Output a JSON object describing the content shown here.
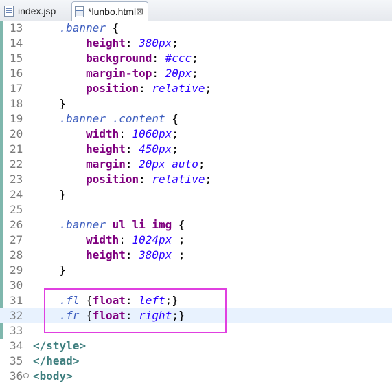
{
  "tabs": [
    {
      "label": "index.jsp",
      "icon": "jsp-file-icon"
    },
    {
      "label": "*lunbo.html",
      "icon": "html-file-icon",
      "close": "⊠",
      "active": true
    }
  ],
  "highlight_color": "#e040e0",
  "lines": [
    {
      "n": "13",
      "tokens": [
        [
          "    ",
          "pun"
        ],
        [
          ".banner",
          "sel"
        ],
        [
          " {",
          "pun"
        ]
      ]
    },
    {
      "n": "14",
      "tokens": [
        [
          "        ",
          "pun"
        ],
        [
          "height",
          "prop"
        ],
        [
          ": ",
          "pun"
        ],
        [
          "380px",
          "val"
        ],
        [
          ";",
          "pun"
        ]
      ]
    },
    {
      "n": "15",
      "tokens": [
        [
          "        ",
          "pun"
        ],
        [
          "background",
          "prop"
        ],
        [
          ": ",
          "pun"
        ],
        [
          "#ccc",
          "val"
        ],
        [
          ";",
          "pun"
        ]
      ]
    },
    {
      "n": "16",
      "tokens": [
        [
          "        ",
          "pun"
        ],
        [
          "margin-top",
          "prop"
        ],
        [
          ": ",
          "pun"
        ],
        [
          "20px",
          "val"
        ],
        [
          ";",
          "pun"
        ]
      ]
    },
    {
      "n": "17",
      "tokens": [
        [
          "        ",
          "pun"
        ],
        [
          "position",
          "prop"
        ],
        [
          ": ",
          "pun"
        ],
        [
          "relative",
          "val"
        ],
        [
          ";",
          "pun"
        ]
      ]
    },
    {
      "n": "18",
      "tokens": [
        [
          "    ",
          "pun"
        ],
        [
          "}",
          "pun"
        ]
      ]
    },
    {
      "n": "19",
      "tokens": [
        [
          "    ",
          "pun"
        ],
        [
          ".banner .content",
          "sel"
        ],
        [
          " {",
          "pun"
        ]
      ]
    },
    {
      "n": "20",
      "tokens": [
        [
          "        ",
          "pun"
        ],
        [
          "width",
          "prop"
        ],
        [
          ": ",
          "pun"
        ],
        [
          "1060px",
          "val"
        ],
        [
          ";",
          "pun"
        ]
      ]
    },
    {
      "n": "21",
      "tokens": [
        [
          "        ",
          "pun"
        ],
        [
          "height",
          "prop"
        ],
        [
          ": ",
          "pun"
        ],
        [
          "450px",
          "val"
        ],
        [
          ";",
          "pun"
        ]
      ]
    },
    {
      "n": "22",
      "tokens": [
        [
          "        ",
          "pun"
        ],
        [
          "margin",
          "prop"
        ],
        [
          ": ",
          "pun"
        ],
        [
          "20px auto",
          "val"
        ],
        [
          ";",
          "pun"
        ]
      ]
    },
    {
      "n": "23",
      "tokens": [
        [
          "        ",
          "pun"
        ],
        [
          "position",
          "prop"
        ],
        [
          ": ",
          "pun"
        ],
        [
          "relative",
          "val"
        ],
        [
          ";",
          "pun"
        ]
      ]
    },
    {
      "n": "24",
      "tokens": [
        [
          "    ",
          "pun"
        ],
        [
          "}",
          "pun"
        ]
      ]
    },
    {
      "n": "25",
      "tokens": []
    },
    {
      "n": "26",
      "tokens": [
        [
          "    ",
          "pun"
        ],
        [
          ".banner",
          "sel"
        ],
        [
          " ul li img",
          "prop"
        ],
        [
          " {",
          "pun"
        ]
      ]
    },
    {
      "n": "27",
      "tokens": [
        [
          "        ",
          "pun"
        ],
        [
          "width",
          "prop"
        ],
        [
          ": ",
          "pun"
        ],
        [
          "1024px",
          "val"
        ],
        [
          " ;",
          "pun"
        ]
      ]
    },
    {
      "n": "28",
      "tokens": [
        [
          "        ",
          "pun"
        ],
        [
          "height",
          "prop"
        ],
        [
          ": ",
          "pun"
        ],
        [
          "380px",
          "val"
        ],
        [
          " ;",
          "pun"
        ]
      ]
    },
    {
      "n": "29",
      "tokens": [
        [
          "    ",
          "pun"
        ],
        [
          "}",
          "pun"
        ]
      ]
    },
    {
      "n": "30",
      "tokens": []
    },
    {
      "n": "31",
      "tokens": [
        [
          "    ",
          "pun"
        ],
        [
          ".fl",
          "sel"
        ],
        [
          " {",
          "pun"
        ],
        [
          "float",
          "prop"
        ],
        [
          ": ",
          "pun"
        ],
        [
          "left",
          "val"
        ],
        [
          ";}",
          "pun"
        ]
      ]
    },
    {
      "n": "32",
      "tokens": [
        [
          "    ",
          "pun"
        ],
        [
          ".fr",
          "sel"
        ],
        [
          " {",
          "pun"
        ],
        [
          "float",
          "prop"
        ],
        [
          ": ",
          "pun"
        ],
        [
          "right",
          "val"
        ],
        [
          ";}",
          "pun"
        ]
      ],
      "current": true
    },
    {
      "n": "33",
      "tokens": []
    },
    {
      "n": "34",
      "tokens": [
        [
          "</style>",
          "tag"
        ]
      ]
    },
    {
      "n": "35",
      "tokens": [
        [
          "</head>",
          "tag"
        ]
      ]
    },
    {
      "n": "36",
      "tokens": [
        [
          "<body>",
          "tag"
        ]
      ],
      "fold": true
    }
  ]
}
